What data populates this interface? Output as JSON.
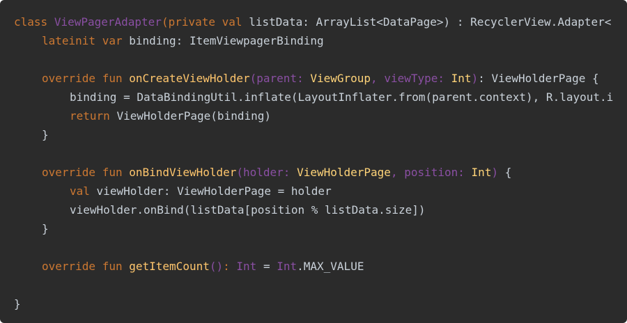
{
  "code": {
    "l1": {
      "kw_class": "class",
      "class_name": "ViewPagerAdapter",
      "open": "(",
      "kw_private": "private",
      "kw_val": "val",
      "rest": "listData: ArrayList<DataPage>) : RecyclerView.Adapter<"
    },
    "l2": {
      "kw_lateinit": "lateinit",
      "kw_var": "var",
      "rest": "binding: ItemViewpagerBinding"
    },
    "l4": {
      "kw_override": "override",
      "kw_fun": "fun",
      "fn_name": "onCreateViewHolder",
      "p_open": "(parent:",
      "t1": "ViewGroup",
      "p_mid": ", viewType:",
      "t2": "Int",
      "p_close": ")",
      "rest": ": ViewHolderPage {"
    },
    "l5": {
      "text": "binding = DataBindingUtil.inflate(LayoutInflater.from(parent.context), R.layout.i"
    },
    "l6": {
      "kw_return": "return",
      "rest": "ViewHolderPage(binding)"
    },
    "l7": {
      "text": "}"
    },
    "l9": {
      "kw_override": "override",
      "kw_fun": "fun",
      "fn_name": "onBindViewHolder",
      "p_open": "(holder:",
      "t1": "ViewHolderPage",
      "p_mid": ", position:",
      "t2": "Int",
      "p_close": ")",
      "rest": " {"
    },
    "l10": {
      "kw_val": "val",
      "rest": "viewHolder: ViewHolderPage = holder"
    },
    "l11": {
      "text": "viewHolder.onBind(listData[position % listData.size])"
    },
    "l12": {
      "text": "}"
    },
    "l14": {
      "kw_override": "override",
      "kw_fun": "fun",
      "fn_name": "getItemCount",
      "parens": "()",
      "colon": ":",
      "t_int": "Int",
      "eq": "=",
      "int2": "Int",
      "rest": ".MAX_VALUE"
    },
    "l16": {
      "text": "}"
    }
  }
}
